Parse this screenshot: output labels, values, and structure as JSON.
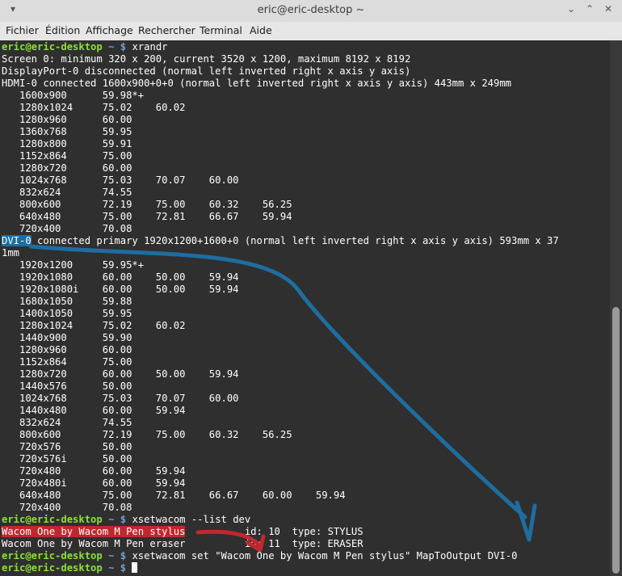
{
  "window": {
    "title": "eric@eric-desktop ~",
    "menu_icon": "chevron-down",
    "controls": [
      "minimize",
      "maximize",
      "close"
    ]
  },
  "menu": [
    "Fichier",
    "Édition",
    "Affichage",
    "Rechercher",
    "Terminal",
    "Aide"
  ],
  "prompt": {
    "user": "eric@eric-desktop",
    "path": "~",
    "sym": "$"
  },
  "terminal": [
    {
      "type": "prompt",
      "cmd": "xrandr"
    },
    {
      "type": "text",
      "text": "Screen 0: minimum 320 x 200, current 3520 x 1200, maximum 8192 x 8192"
    },
    {
      "type": "text",
      "text": "DisplayPort-0 disconnected (normal left inverted right x axis y axis)"
    },
    {
      "type": "text",
      "text": "HDMI-0 connected 1600x900+0+0 (normal left inverted right x axis y axis) 443mm x 249mm"
    },
    {
      "type": "text",
      "text": "   1600x900      59.98*+"
    },
    {
      "type": "text",
      "text": "   1280x1024     75.02    60.02"
    },
    {
      "type": "text",
      "text": "   1280x960      60.00"
    },
    {
      "type": "text",
      "text": "   1360x768      59.95"
    },
    {
      "type": "text",
      "text": "   1280x800      59.91"
    },
    {
      "type": "text",
      "text": "   1152x864      75.00"
    },
    {
      "type": "text",
      "text": "   1280x720      60.00"
    },
    {
      "type": "text",
      "text": "   1024x768      75.03    70.07    60.00"
    },
    {
      "type": "text",
      "text": "   832x624       74.55"
    },
    {
      "type": "text",
      "text": "   800x600       72.19    75.00    60.32    56.25"
    },
    {
      "type": "text",
      "text": "   640x480       75.00    72.81    66.67    59.94"
    },
    {
      "type": "text",
      "text": "   720x400       70.08"
    },
    {
      "type": "hl",
      "hl": "DVI-0",
      "rest": " connected primary 1920x1200+1600+0 (normal left inverted right x axis y axis) 593mm x 37",
      "color": "blue"
    },
    {
      "type": "text",
      "text": "1mm"
    },
    {
      "type": "text",
      "text": "   1920x1200     59.95*+"
    },
    {
      "type": "text",
      "text": "   1920x1080     60.00    50.00    59.94"
    },
    {
      "type": "text",
      "text": "   1920x1080i    60.00    50.00    59.94"
    },
    {
      "type": "text",
      "text": "   1680x1050     59.88"
    },
    {
      "type": "text",
      "text": "   1400x1050     59.95"
    },
    {
      "type": "text",
      "text": "   1280x1024     75.02    60.02"
    },
    {
      "type": "text",
      "text": "   1440x900      59.90"
    },
    {
      "type": "text",
      "text": "   1280x960      60.00"
    },
    {
      "type": "text",
      "text": "   1152x864      75.00"
    },
    {
      "type": "text",
      "text": "   1280x720      60.00    50.00    59.94"
    },
    {
      "type": "text",
      "text": "   1440x576      50.00"
    },
    {
      "type": "text",
      "text": "   1024x768      75.03    70.07    60.00"
    },
    {
      "type": "text",
      "text": "   1440x480      60.00    59.94"
    },
    {
      "type": "text",
      "text": "   832x624       74.55"
    },
    {
      "type": "text",
      "text": "   800x600       72.19    75.00    60.32    56.25"
    },
    {
      "type": "text",
      "text": "   720x576       50.00"
    },
    {
      "type": "text",
      "text": "   720x576i      50.00"
    },
    {
      "type": "text",
      "text": "   720x480       60.00    59.94"
    },
    {
      "type": "text",
      "text": "   720x480i      60.00    59.94"
    },
    {
      "type": "text",
      "text": "   640x480       75.00    72.81    66.67    60.00    59.94"
    },
    {
      "type": "text",
      "text": "   720x400       70.08"
    },
    {
      "type": "prompt",
      "cmd": "xsetwacom --list dev"
    },
    {
      "type": "hl",
      "hl": "Wacom One by Wacom M Pen stylus",
      "rest": "          id: 10  type: STYLUS",
      "color": "red"
    },
    {
      "type": "text",
      "text": "Wacom One by Wacom M Pen eraser          id: 11  type: ERASER"
    },
    {
      "type": "prompt",
      "cmd": "xsetwacom set \"Wacom One by Wacom M Pen stylus\" MapToOutput DVI-0"
    },
    {
      "type": "prompt",
      "cmd": "",
      "cursor": true
    }
  ],
  "colors": {
    "prompt": "#8ae234",
    "path": "#729fcf",
    "background": "#2f2f2f",
    "annotation_blue": "#1e6da0",
    "annotation_red": "#c1272d"
  }
}
